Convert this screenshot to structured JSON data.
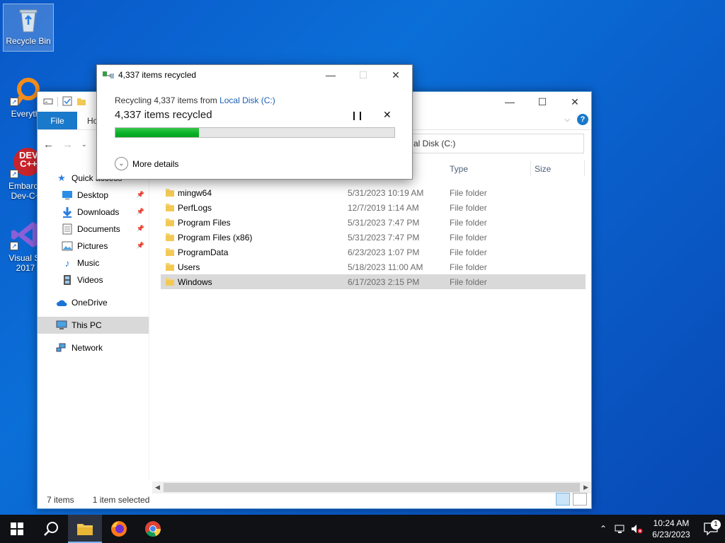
{
  "desktop": {
    "icons": [
      {
        "label": "Recycle Bin"
      },
      {
        "label": "Everyth"
      },
      {
        "label": "Embarca\nDev-C+"
      },
      {
        "label": "Visual St\n2017"
      }
    ],
    "dev_logo_text": "DEV\nC++"
  },
  "explorer": {
    "tabs": {
      "file": "File",
      "home": "Ho"
    },
    "address": "al Disk (C:)",
    "columns": {
      "type": "Type",
      "size": "Size"
    },
    "sidebar": [
      {
        "label": "Quick access",
        "pinned": false
      },
      {
        "label": "Desktop",
        "pinned": true
      },
      {
        "label": "Downloads",
        "pinned": true
      },
      {
        "label": "Documents",
        "pinned": true
      },
      {
        "label": "Pictures",
        "pinned": true
      },
      {
        "label": "Music",
        "pinned": false
      },
      {
        "label": "Videos",
        "pinned": false
      },
      {
        "label": "OneDrive",
        "pinned": false
      },
      {
        "label": "This PC",
        "pinned": false
      },
      {
        "label": "Network",
        "pinned": false
      }
    ],
    "files": [
      {
        "name": "mingw64",
        "date": "5/31/2023 10:19 AM",
        "type": "File folder"
      },
      {
        "name": "PerfLogs",
        "date": "12/7/2019 1:14 AM",
        "type": "File folder"
      },
      {
        "name": "Program Files",
        "date": "5/31/2023 7:47 PM",
        "type": "File folder"
      },
      {
        "name": "Program Files (x86)",
        "date": "5/31/2023 7:47 PM",
        "type": "File folder"
      },
      {
        "name": "ProgramData",
        "date": "6/23/2023 1:07 PM",
        "type": "File folder"
      },
      {
        "name": "Users",
        "date": "5/18/2023 11:00 AM",
        "type": "File folder"
      },
      {
        "name": "Windows",
        "date": "6/17/2023 2:15 PM",
        "type": "File folder"
      }
    ],
    "status": {
      "count": "7 items",
      "selection": "1 item selected"
    }
  },
  "dialog": {
    "title": "4,337 items recycled",
    "line1_prefix": "Recycling 4,337 items from ",
    "line1_link": "Local Disk (C:)",
    "heading": "4,337 items recycled",
    "progress_fraction": 0.3,
    "more_details": "More details"
  },
  "taskbar": {
    "time": "10:24 AM",
    "date": "6/23/2023",
    "notification_count": "1"
  },
  "colors": {
    "accent": "#1979ca",
    "progress": "#06b025",
    "link": "#1a5fb4"
  }
}
